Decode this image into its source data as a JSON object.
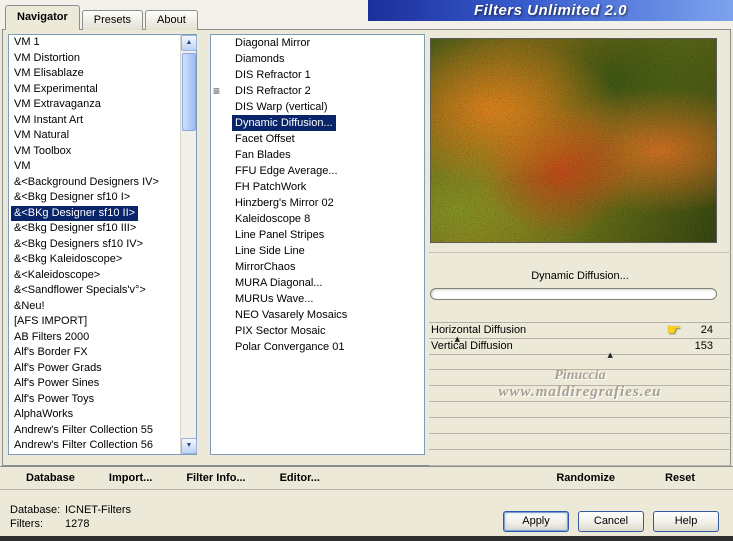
{
  "window": {
    "title": "Filters Unlimited 2.0"
  },
  "tabs": [
    {
      "label": "Navigator",
      "active": true
    },
    {
      "label": "Presets"
    },
    {
      "label": "About"
    }
  ],
  "categories": [
    {
      "label": "VM 1"
    },
    {
      "label": "VM Distortion"
    },
    {
      "label": "VM Elisablaze"
    },
    {
      "label": "VM Experimental"
    },
    {
      "label": "VM Extravaganza"
    },
    {
      "label": "VM Instant Art"
    },
    {
      "label": "VM Natural"
    },
    {
      "label": "VM Toolbox"
    },
    {
      "label": "VM"
    },
    {
      "label": "&<Background Designers IV>"
    },
    {
      "label": "&<Bkg Designer sf10 I>"
    },
    {
      "label": "&<BKg Designer sf10 II>",
      "selected": true
    },
    {
      "label": "&<Bkg Designer sf10 III>"
    },
    {
      "label": "&<Bkg Designers sf10 IV>"
    },
    {
      "label": "&<Bkg Kaleidoscope>"
    },
    {
      "label": "&<Kaleidoscope>"
    },
    {
      "label": "&<Sandflower Specials'v°>"
    },
    {
      "label": "&Neu!"
    },
    {
      "label": "[AFS IMPORT]"
    },
    {
      "label": "AB Filters 2000"
    },
    {
      "label": "Alf's Border FX"
    },
    {
      "label": "Alf's Power Grads"
    },
    {
      "label": "Alf's Power Sines"
    },
    {
      "label": "Alf's Power Toys"
    },
    {
      "label": "AlphaWorks"
    },
    {
      "label": "Andrew's Filter Collection 55"
    },
    {
      "label": "Andrew's Filter Collection 56"
    }
  ],
  "filters": [
    {
      "label": "Diagonal Mirror"
    },
    {
      "label": "Diamonds"
    },
    {
      "label": "DIS Refractor 1"
    },
    {
      "label": "DIS Refractor 2",
      "grip": true
    },
    {
      "label": "DIS Warp (vertical)"
    },
    {
      "label": "Dynamic Diffusion...",
      "selected": true
    },
    {
      "label": "Facet Offset"
    },
    {
      "label": "Fan Blades"
    },
    {
      "label": "FFU Edge Average..."
    },
    {
      "label": "FH PatchWork"
    },
    {
      "label": "Hinzberg's Mirror 02"
    },
    {
      "label": "Kaleidoscope 8"
    },
    {
      "label": "Line Panel Stripes"
    },
    {
      "label": "Line Side Line"
    },
    {
      "label": "MirrorChaos"
    },
    {
      "label": "MURA Diagonal..."
    },
    {
      "label": "MURUs Wave..."
    },
    {
      "label": "NEO Vasarely Mosaics"
    },
    {
      "label": "PIX Sector Mosaic"
    },
    {
      "label": "Polar Convergance 01"
    }
  ],
  "preview": {
    "filter_name": "Dynamic Diffusion..."
  },
  "parameters": [
    {
      "label": "Horizontal Diffusion",
      "value": 24,
      "slider_fraction": 0.094,
      "hand_pointer": true
    },
    {
      "label": "Vertical Diffusion",
      "value": 153,
      "slider_fraction": 0.6
    }
  ],
  "watermark": {
    "line1": "Pinuccia",
    "line2": "www.maldiregrafies.eu"
  },
  "toolbar": {
    "left": [
      {
        "label": "Database"
      },
      {
        "label": "Import..."
      },
      {
        "label": "Filter Info..."
      },
      {
        "label": "Editor..."
      }
    ],
    "right": [
      {
        "label": "Randomize"
      },
      {
        "label": "Reset"
      }
    ]
  },
  "status": {
    "database_label": "Database:",
    "database_value": "ICNET-Filters",
    "filters_label": "Filters:",
    "filters_value": "1278"
  },
  "action_buttons": [
    {
      "label": "Apply",
      "focused": true
    },
    {
      "label": "Cancel"
    },
    {
      "label": "Help"
    }
  ],
  "colors": {
    "selection": "#0a246a",
    "title_gradient_start": "#1b2f9b",
    "title_gradient_end": "#7da3ee",
    "hand_icon": "#ffd21e"
  }
}
